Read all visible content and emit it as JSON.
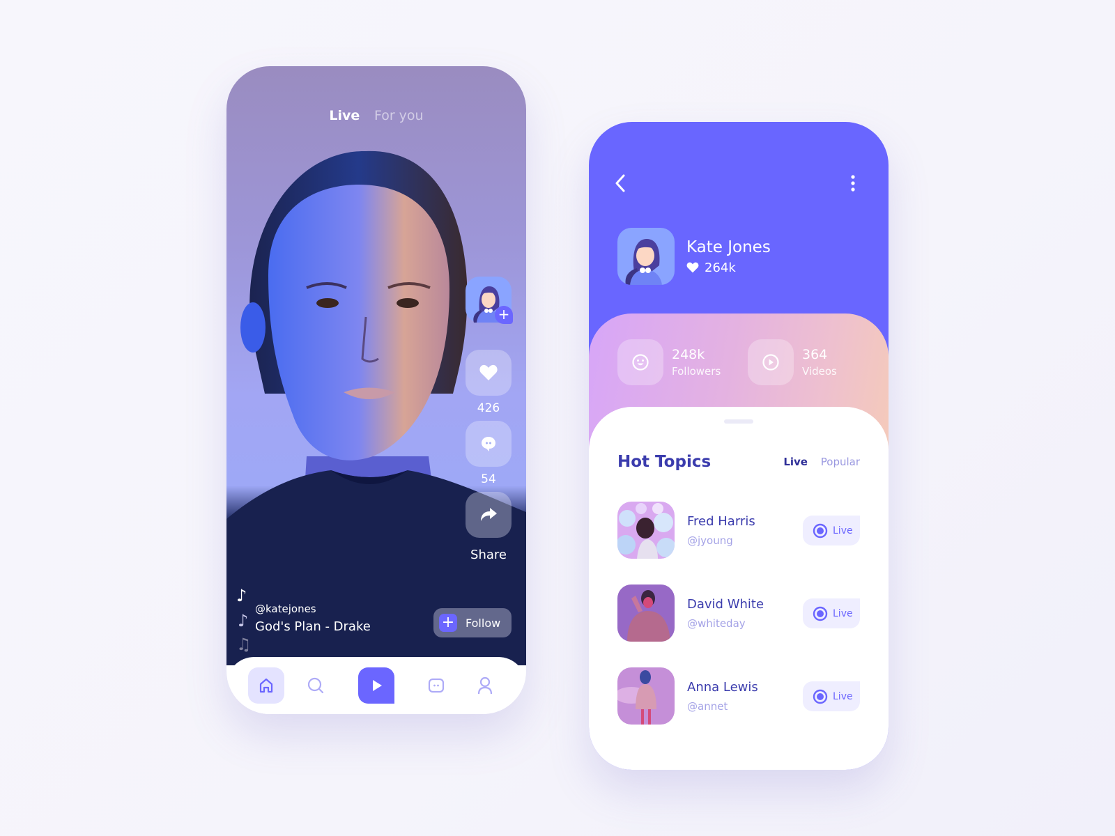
{
  "colors": {
    "accent": "#6b66ff",
    "header_bg": "#6966ff",
    "title_text": "#3b3cad",
    "muted_text": "#a4a2e6",
    "chip_bg": "#efeeff"
  },
  "feed": {
    "tabs": [
      {
        "label": "Live",
        "active": true
      },
      {
        "label": "For you",
        "active": false
      }
    ],
    "creator_avatar_icon": "user-avatar-plus-icon",
    "actions": {
      "like_icon": "heart-icon",
      "like_count": "426",
      "comment_icon": "chat-bubble-icon",
      "comment_count": "54",
      "share_icon": "share-arrow-icon",
      "share_label": "Share"
    },
    "username": "@katejones",
    "song": "God's Plan - Drake",
    "follow_label": "Follow",
    "nav": [
      {
        "icon": "home-icon",
        "active": true
      },
      {
        "icon": "search-icon",
        "active": false
      },
      {
        "icon": "play-icon",
        "active": false
      },
      {
        "icon": "chat-icon",
        "active": false
      },
      {
        "icon": "profile-icon",
        "active": false
      }
    ]
  },
  "profile": {
    "back_icon": "chevron-left-icon",
    "more_icon": "more-vertical-icon",
    "name": "Kate Jones",
    "likes": "264k",
    "stats": [
      {
        "icon": "smiley-icon",
        "value": "248k",
        "label": "Followers"
      },
      {
        "icon": "play-circle-icon",
        "value": "364",
        "label": "Videos"
      }
    ],
    "section_title": "Hot Topics",
    "section_tabs": [
      {
        "label": "Live",
        "active": true
      },
      {
        "label": "Popular",
        "active": false
      }
    ],
    "topics": [
      {
        "name": "Fred Harris",
        "handle": "@jyoung",
        "status": "Live"
      },
      {
        "name": "David White",
        "handle": "@whiteday",
        "status": "Live"
      },
      {
        "name": "Anna Lewis",
        "handle": "@annet",
        "status": "Live"
      }
    ]
  }
}
